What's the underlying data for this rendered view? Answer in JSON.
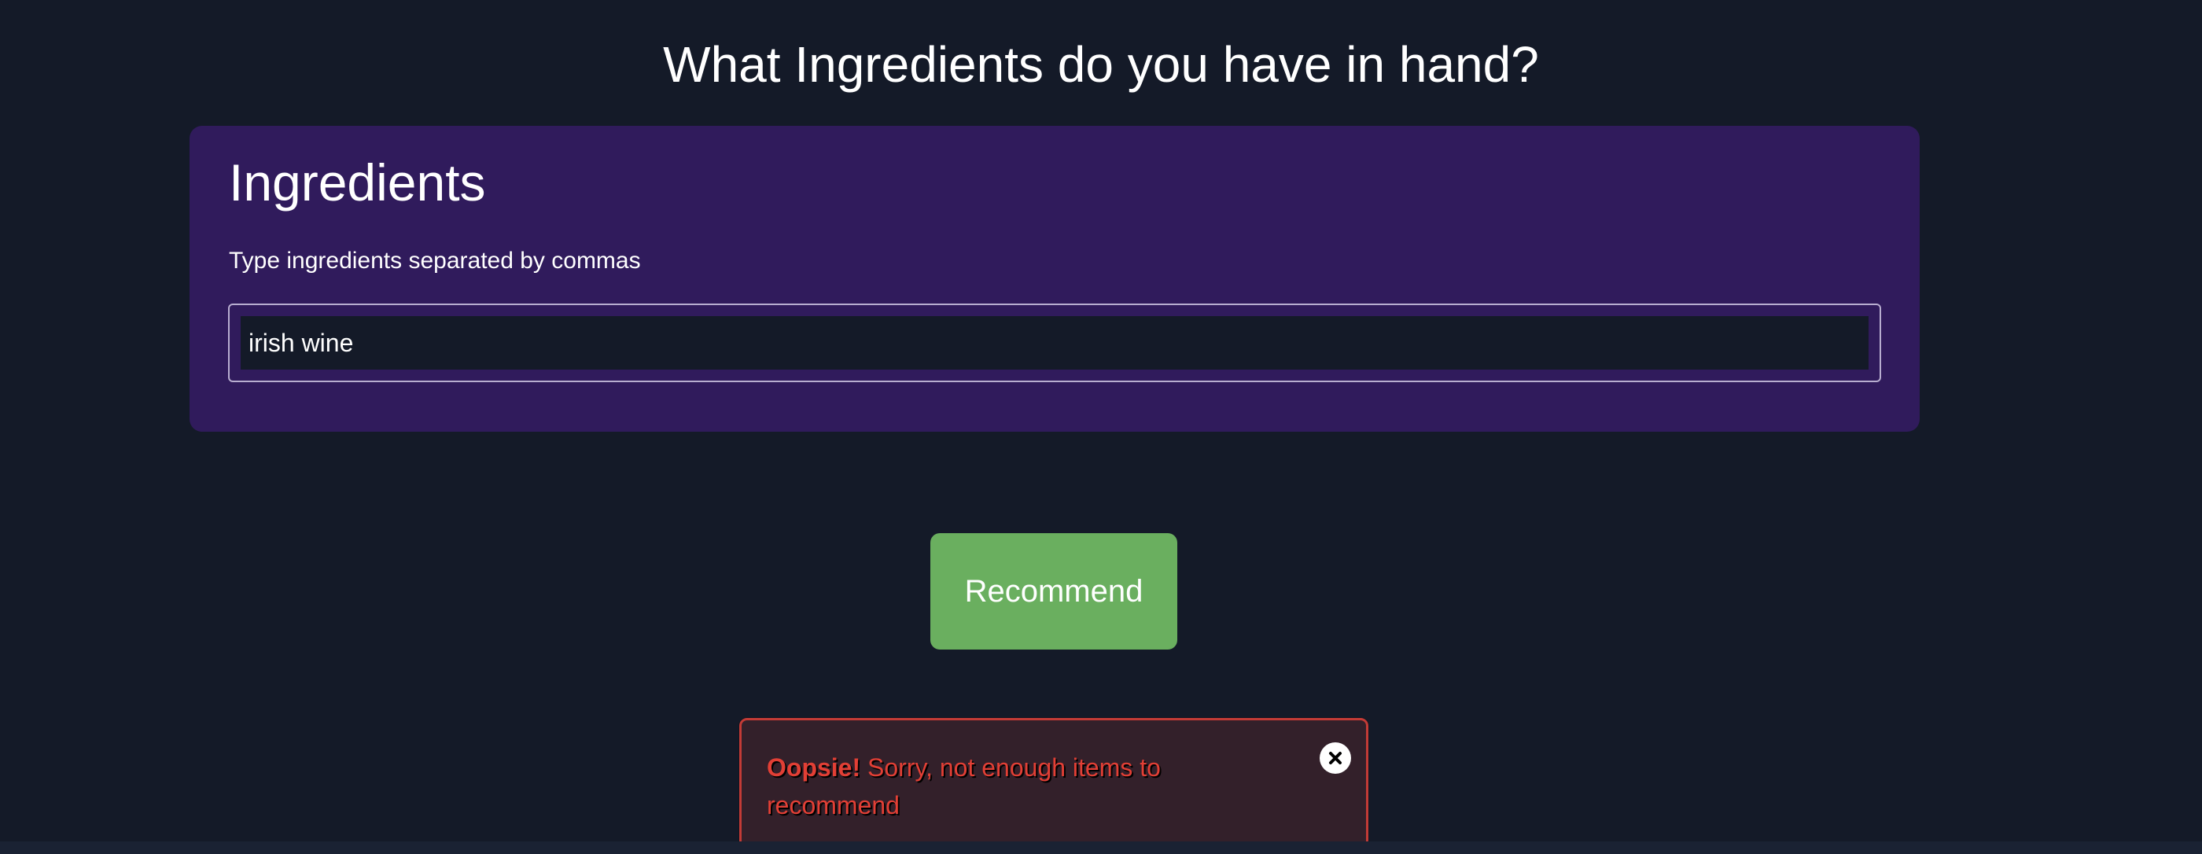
{
  "page": {
    "title": "What Ingredients do you have in hand?"
  },
  "ingredients_card": {
    "title": "Ingredients",
    "hint": "Type ingredients separated by commas",
    "input_value": "irish wine"
  },
  "recommend_button": {
    "label": "Recommend"
  },
  "alert": {
    "strong": "Oopsie!",
    "message": "Sorry, not enough items to recommend",
    "close_icon": "close-icon"
  },
  "colors": {
    "background": "#141a28",
    "card": "#301b5c",
    "button": "#6aaf5f",
    "alert_border": "#c33b36",
    "alert_text": "#e23f35"
  }
}
